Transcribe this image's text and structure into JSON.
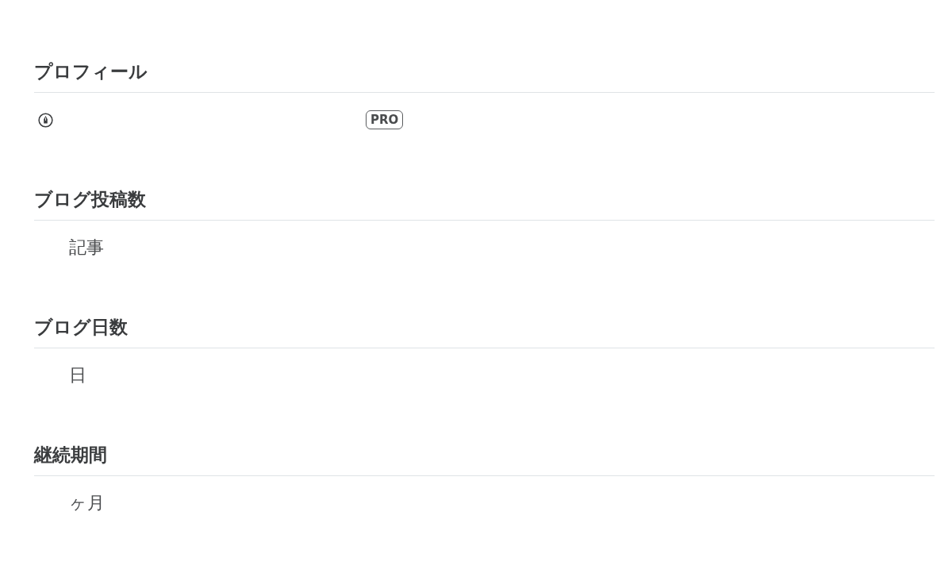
{
  "sections": [
    {
      "title": "プロフィール",
      "kind": "profile",
      "badge": "PRO"
    },
    {
      "title": "ブログ投稿数",
      "kind": "stat",
      "unit": "記事"
    },
    {
      "title": "ブログ日数",
      "kind": "stat",
      "unit": "日"
    },
    {
      "title": "継続期間",
      "kind": "stat",
      "unit": "ヶ月"
    }
  ]
}
